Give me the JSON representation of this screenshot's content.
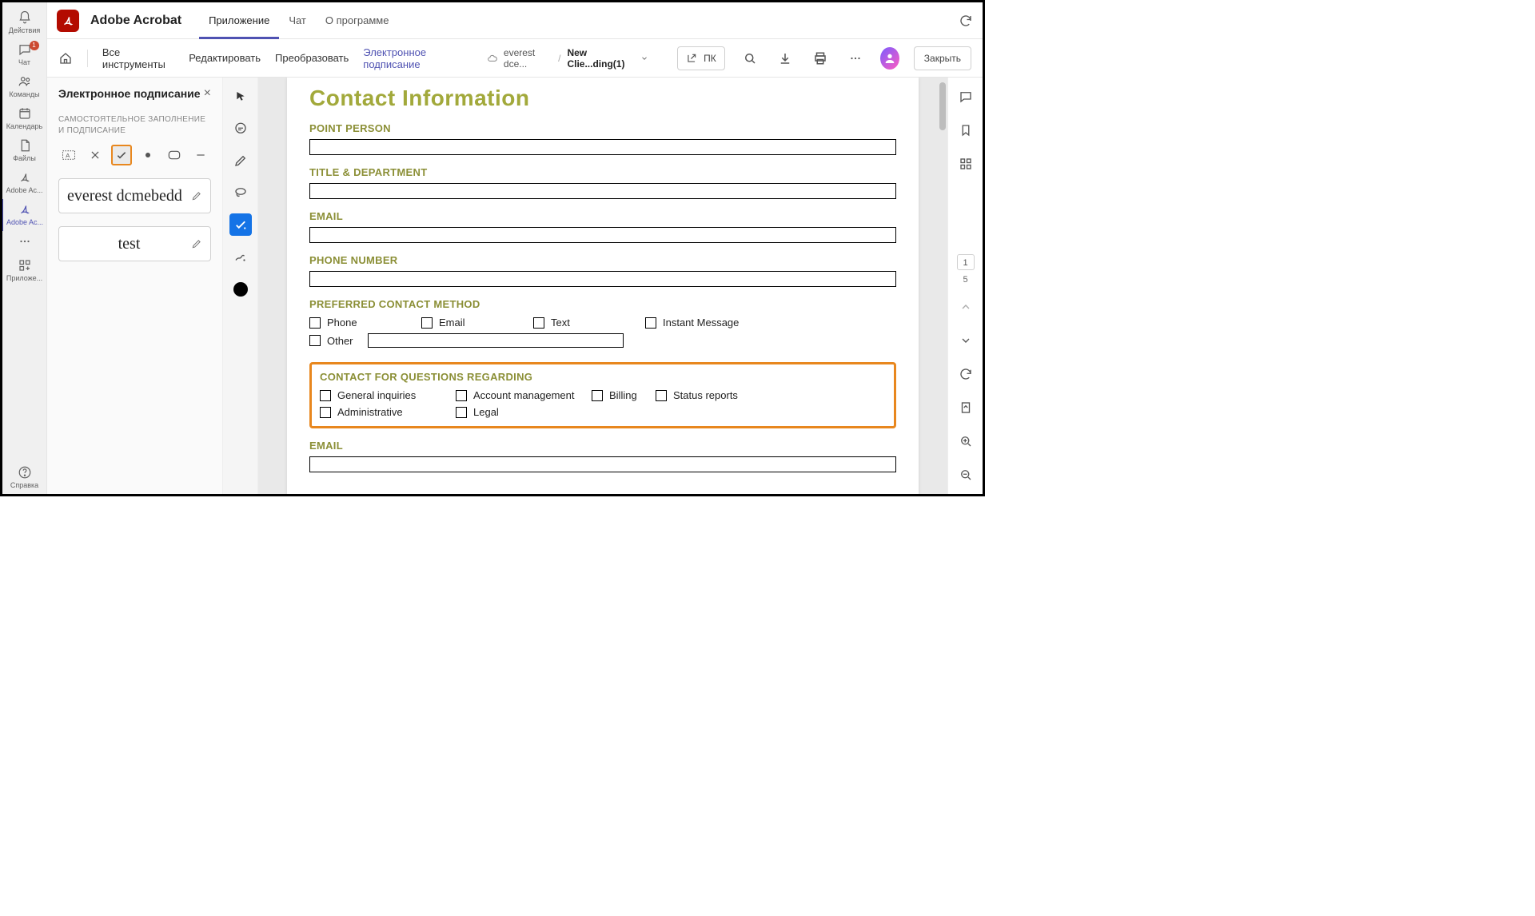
{
  "teams_rail": {
    "items": [
      {
        "label": "Действия"
      },
      {
        "label": "Чат",
        "badge": "1"
      },
      {
        "label": "Команды"
      },
      {
        "label": "Календарь"
      },
      {
        "label": "Файлы"
      },
      {
        "label": "Adobe Ac..."
      },
      {
        "label": "Adobe Ac..."
      },
      {
        "label": ""
      },
      {
        "label": "Приложе..."
      }
    ],
    "help_label": "Справка"
  },
  "header": {
    "app_title": "Adobe Acrobat",
    "tabs": [
      {
        "label": "Приложение",
        "active": true
      },
      {
        "label": "Чат"
      },
      {
        "label": "О программе"
      }
    ]
  },
  "toolbar": {
    "links": [
      {
        "label": "Все инструменты"
      },
      {
        "label": "Редактировать"
      },
      {
        "label": "Преобразовать"
      },
      {
        "label": "Электронное подписание",
        "active": true
      }
    ],
    "crumb_cloud": "everest dce...",
    "crumb_sep": "/",
    "crumb_file": "New Clie...ding(1)",
    "open_btn": "ПК",
    "close_label": "Закрыть"
  },
  "esign": {
    "title": "Электронное подписание",
    "subtitle": "САМОСТОЯТЕЛЬНОЕ ЗАПОЛНЕНИЕ И ПОДПИСАНИЕ",
    "signature1": "everest dcmebedd",
    "signature2": "test"
  },
  "doc": {
    "title": "Contact Information",
    "labels": {
      "point_person": "POINT PERSON",
      "title_dept": "TITLE & DEPARTMENT",
      "email": "EMAIL",
      "phone": "PHONE NUMBER",
      "preferred": "PREFERRED CONTACT METHOD",
      "contact_for": "CONTACT FOR QUESTIONS REGARDING",
      "email2": "EMAIL"
    },
    "preferred_options": [
      "Phone",
      "Email",
      "Text",
      "Instant Message",
      "Other"
    ],
    "questions_options": [
      "General inquiries",
      "Account management",
      "Billing",
      "Status reports",
      "Administrative",
      "Legal"
    ]
  },
  "right_rail": {
    "current_page": "1",
    "total_pages": "5"
  }
}
